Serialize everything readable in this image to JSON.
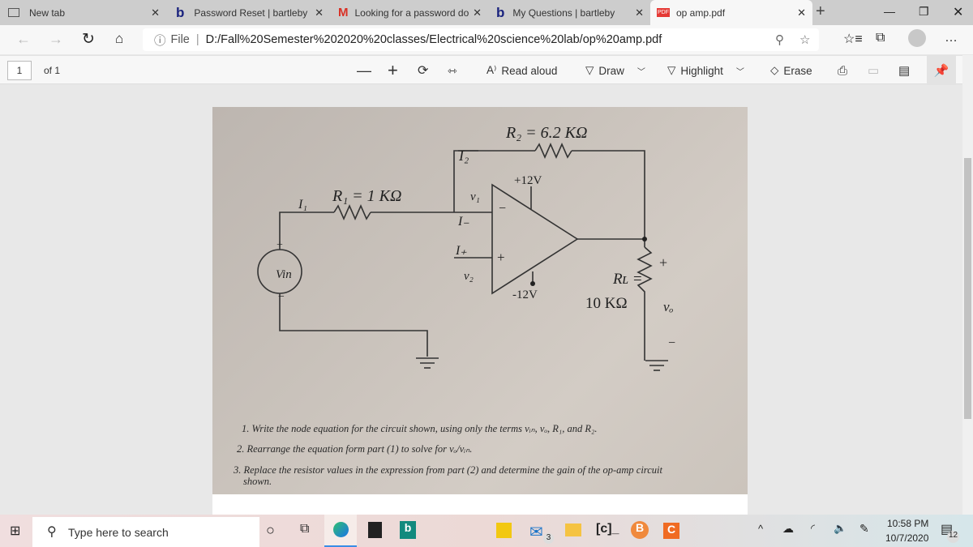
{
  "browser": {
    "tabs": [
      {
        "label": "New tab",
        "icon": "new-tab-icon",
        "active": false
      },
      {
        "label": "Password Reset | bartleby",
        "icon": "bartleby-icon",
        "active": false
      },
      {
        "label": "Looking for a password do",
        "icon": "gmail-icon",
        "active": false
      },
      {
        "label": "My Questions | bartleby",
        "icon": "bartleby-icon",
        "active": false
      },
      {
        "label": "op amp.pdf",
        "icon": "pdf-icon",
        "active": true
      }
    ],
    "address": {
      "scheme": "File",
      "url": "D:/Fall%20Semester%202020%20classes/Electrical%20science%20lab/op%20amp.pdf"
    }
  },
  "pdf_toolbar": {
    "page": "1",
    "of": "of 1",
    "read_aloud": "Read aloud",
    "draw": "Draw",
    "highlight": "Highlight",
    "erase": "Erase"
  },
  "document": {
    "circuit": {
      "r2": "R₂ = 6.2 KΩ",
      "i2": "I₂",
      "plus12": "+12V",
      "r1": "R₁ = 1 KΩ",
      "i1": "I₁",
      "v1": "v₁",
      "i_minus": "I₋",
      "i_plus": "I₊",
      "v2": "v₂",
      "minus12": "-12V",
      "vin": "Vin",
      "rl": "Rʟ =",
      "rl_val": "10 KΩ",
      "vo": "vₒ",
      "minus_sign": "−",
      "plus_sign": "+"
    },
    "questions": [
      "1. Write the node equation for the circuit shown, using only the terms vᵢₙ, vₒ, R₁, and R₂.",
      "2. Rearrange the equation form part (1) to solve for vₒ/vᵢₙ.",
      "3. Replace the resistor values in the expression from part (2) and determine the gain of the op-amp circuit",
      "shown."
    ]
  },
  "taskbar": {
    "search_placeholder": "Type here to search",
    "time": "10:58 PM",
    "date": "10/7/2020",
    "mail_badge": "3",
    "notification_badge": "12"
  }
}
